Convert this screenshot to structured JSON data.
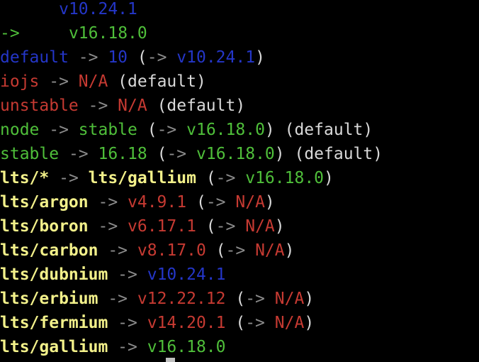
{
  "colors": {
    "white": "#d9d9d9",
    "gray": "#8c8c8c",
    "blue": "#2436c8",
    "green": "#4fbf3a",
    "red": "#c63a32",
    "yellow": "#f2f08a"
  },
  "lines": [
    {
      "segments": [
        {
          "text": "      ",
          "color": "white"
        },
        {
          "text": "v10.24.1",
          "color": "blue"
        }
      ]
    },
    {
      "segments": [
        {
          "text": "->",
          "color": "green"
        },
        {
          "text": "     ",
          "color": "white"
        },
        {
          "text": "v16.18.0",
          "color": "green"
        }
      ]
    },
    {
      "segments": [
        {
          "text": "default",
          "color": "blue"
        },
        {
          "text": " -> ",
          "color": "gray"
        },
        {
          "text": "10",
          "color": "blue"
        },
        {
          "text": " (",
          "color": "white"
        },
        {
          "text": "->",
          "color": "gray"
        },
        {
          "text": " ",
          "color": "white"
        },
        {
          "text": "v10.24.1",
          "color": "blue"
        },
        {
          "text": ")",
          "color": "white"
        }
      ]
    },
    {
      "segments": [
        {
          "text": "iojs",
          "color": "red"
        },
        {
          "text": " -> ",
          "color": "gray"
        },
        {
          "text": "N/A",
          "color": "red"
        },
        {
          "text": " (default)",
          "color": "white"
        }
      ]
    },
    {
      "segments": [
        {
          "text": "unstable",
          "color": "red"
        },
        {
          "text": " -> ",
          "color": "gray"
        },
        {
          "text": "N/A",
          "color": "red"
        },
        {
          "text": " (default)",
          "color": "white"
        }
      ]
    },
    {
      "segments": [
        {
          "text": "node",
          "color": "green"
        },
        {
          "text": " -> ",
          "color": "gray"
        },
        {
          "text": "stable",
          "color": "green"
        },
        {
          "text": " (",
          "color": "white"
        },
        {
          "text": "->",
          "color": "gray"
        },
        {
          "text": " ",
          "color": "white"
        },
        {
          "text": "v16.18.0",
          "color": "green"
        },
        {
          "text": ") (default)",
          "color": "white"
        }
      ]
    },
    {
      "segments": [
        {
          "text": "stable",
          "color": "green"
        },
        {
          "text": " -> ",
          "color": "gray"
        },
        {
          "text": "16.18",
          "color": "green"
        },
        {
          "text": " (",
          "color": "white"
        },
        {
          "text": "->",
          "color": "gray"
        },
        {
          "text": " ",
          "color": "white"
        },
        {
          "text": "v16.18.0",
          "color": "green"
        },
        {
          "text": ") (default)",
          "color": "white"
        }
      ]
    },
    {
      "segments": [
        {
          "text": "lts/*",
          "color": "yellow"
        },
        {
          "text": " -> ",
          "color": "gray"
        },
        {
          "text": "lts/gallium",
          "color": "yellow"
        },
        {
          "text": " (",
          "color": "white"
        },
        {
          "text": "->",
          "color": "gray"
        },
        {
          "text": " ",
          "color": "white"
        },
        {
          "text": "v16.18.0",
          "color": "green"
        },
        {
          "text": ")",
          "color": "white"
        }
      ]
    },
    {
      "segments": [
        {
          "text": "lts/argon",
          "color": "yellow"
        },
        {
          "text": " -> ",
          "color": "gray"
        },
        {
          "text": "v4.9.1",
          "color": "red"
        },
        {
          "text": " (",
          "color": "white"
        },
        {
          "text": "->",
          "color": "gray"
        },
        {
          "text": " ",
          "color": "white"
        },
        {
          "text": "N/A",
          "color": "red"
        },
        {
          "text": ")",
          "color": "white"
        }
      ]
    },
    {
      "segments": [
        {
          "text": "lts/boron",
          "color": "yellow"
        },
        {
          "text": " -> ",
          "color": "gray"
        },
        {
          "text": "v6.17.1",
          "color": "red"
        },
        {
          "text": " (",
          "color": "white"
        },
        {
          "text": "->",
          "color": "gray"
        },
        {
          "text": " ",
          "color": "white"
        },
        {
          "text": "N/A",
          "color": "red"
        },
        {
          "text": ")",
          "color": "white"
        }
      ]
    },
    {
      "segments": [
        {
          "text": "lts/carbon",
          "color": "yellow"
        },
        {
          "text": " -> ",
          "color": "gray"
        },
        {
          "text": "v8.17.0",
          "color": "red"
        },
        {
          "text": " (",
          "color": "white"
        },
        {
          "text": "->",
          "color": "gray"
        },
        {
          "text": " ",
          "color": "white"
        },
        {
          "text": "N/A",
          "color": "red"
        },
        {
          "text": ")",
          "color": "white"
        }
      ]
    },
    {
      "segments": [
        {
          "text": "lts/dubnium",
          "color": "yellow"
        },
        {
          "text": " -> ",
          "color": "gray"
        },
        {
          "text": "v10.24.1",
          "color": "blue"
        }
      ]
    },
    {
      "segments": [
        {
          "text": "lts/erbium",
          "color": "yellow"
        },
        {
          "text": " -> ",
          "color": "gray"
        },
        {
          "text": "v12.22.12",
          "color": "red"
        },
        {
          "text": " (",
          "color": "white"
        },
        {
          "text": "->",
          "color": "gray"
        },
        {
          "text": " ",
          "color": "white"
        },
        {
          "text": "N/A",
          "color": "red"
        },
        {
          "text": ")",
          "color": "white"
        }
      ]
    },
    {
      "segments": [
        {
          "text": "lts/fermium",
          "color": "yellow"
        },
        {
          "text": " -> ",
          "color": "gray"
        },
        {
          "text": "v14.20.1",
          "color": "red"
        },
        {
          "text": " (",
          "color": "white"
        },
        {
          "text": "->",
          "color": "gray"
        },
        {
          "text": " ",
          "color": "white"
        },
        {
          "text": "N/A",
          "color": "red"
        },
        {
          "text": ")",
          "color": "white"
        }
      ]
    },
    {
      "segments": [
        {
          "text": "lts/gallium",
          "color": "yellow"
        },
        {
          "text": " -> ",
          "color": "gray"
        },
        {
          "text": "v16.18.0",
          "color": "green"
        }
      ]
    }
  ]
}
